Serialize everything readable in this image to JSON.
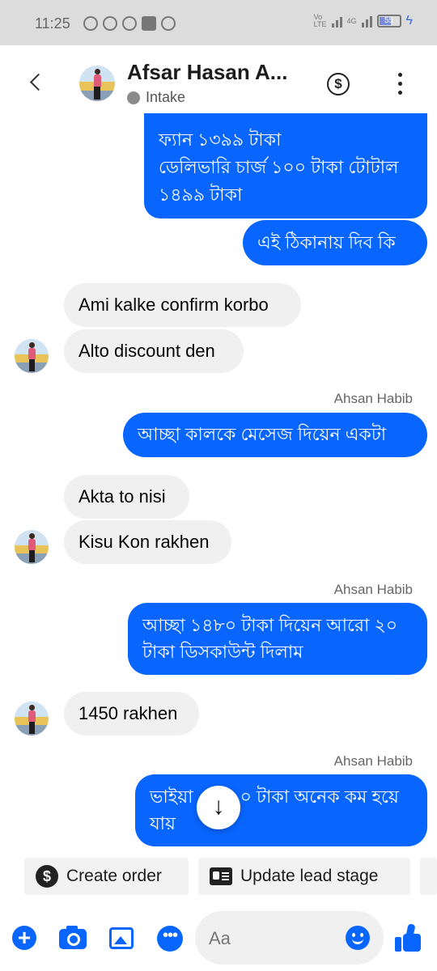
{
  "status_bar": {
    "time": "11:25",
    "network_top": "Vo",
    "network_bottom": "LTE",
    "data_label": "4G",
    "battery": "55",
    "notification_icons": [
      "messenger-icon",
      "vpn-icon",
      "arrow-icon",
      "v-app-icon",
      "android-icon"
    ]
  },
  "header": {
    "name": "Afsar Hasan A...",
    "status": "Intake"
  },
  "messages": [
    {
      "text": "ফ্যান ১৩৯৯ টাকা\nডেলিভারি চার্জ ১০০ টাকা টোটাল\n১৪৯৯ টাকা"
    },
    {
      "text": "এই ঠিকানায় দিব কি"
    },
    {
      "text": "Ami kalke confirm korbo"
    },
    {
      "text": "Alto discount den"
    },
    {
      "sender": "Ahsan Habib",
      "text": "আচ্ছা কালকে মেসেজ দিয়েন একটা"
    },
    {
      "text": "Akta to nisi"
    },
    {
      "text": "Kisu Kon rakhen"
    },
    {
      "sender": "Ahsan Habib",
      "text": "আচ্ছা ১৪৮০ টাকা দিয়েন আরো ২০\nটাকা ডিসকাউন্ট দিলাম"
    },
    {
      "text": "1450 rakhen"
    },
    {
      "sender": "Ahsan Habib",
      "text_before": "ভাইয়া",
      "text_after": "০ টাকা অনেক কম হয়ে",
      "text_line2": "যায়"
    }
  ],
  "quick_actions": {
    "create_order": "Create order",
    "update_lead_stage": "Update lead stage"
  },
  "composer": {
    "placeholder": "Aa"
  },
  "colors": {
    "outgoing_bubble": "#0866ff",
    "incoming_bubble": "#f0f0f0",
    "accent": "#0866ff"
  }
}
